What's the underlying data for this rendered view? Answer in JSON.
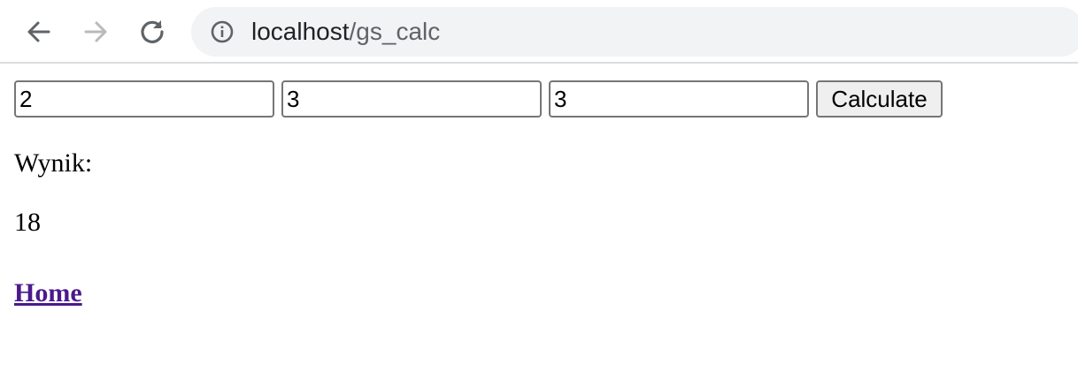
{
  "browser": {
    "url_host": "localhost",
    "url_path": "/gs_calc",
    "icons": {
      "back": "arrow-left-icon",
      "forward": "arrow-right-icon",
      "reload": "reload-icon",
      "site_info": "info-icon"
    },
    "forward_enabled": false
  },
  "form": {
    "inputs": [
      {
        "value": "2"
      },
      {
        "value": "3"
      },
      {
        "value": "3"
      }
    ],
    "button_label": "Calculate"
  },
  "result": {
    "label": "Wynik:",
    "value": "18"
  },
  "link": {
    "label": "Home",
    "color": "#4b1a8b"
  }
}
